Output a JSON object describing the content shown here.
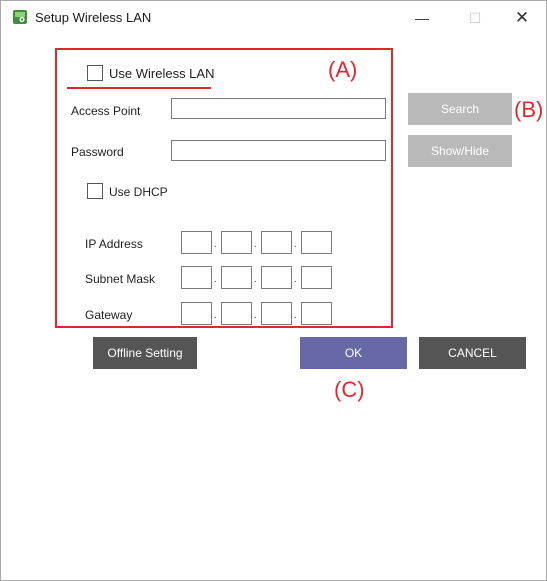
{
  "window": {
    "title": "Setup Wireless LAN",
    "min_glyph": "—",
    "max_glyph": "☐",
    "close_glyph": "✕"
  },
  "form": {
    "use_wireless_label": "Use Wireless LAN",
    "access_point_label": "Access Point",
    "access_point_value": "",
    "password_label": "Password",
    "password_value": "",
    "use_dhcp_label": "Use DHCP",
    "ip_address_label": "IP Address",
    "subnet_mask_label": "Subnet Mask",
    "gateway_label": "Gateway",
    "octet_separator": "."
  },
  "buttons": {
    "search": "Search",
    "show_hide": "Show/Hide",
    "offline_setting": "Offline Setting",
    "ok": "OK",
    "cancel": "CANCEL"
  },
  "annotations": {
    "a": "(A)",
    "b": "(B)",
    "c": "(C)"
  },
  "colors": {
    "annotation_red": "#e3262c",
    "button_gray": "#b9b9b9",
    "button_dark": "#555555",
    "button_purple": "#6669a6"
  }
}
